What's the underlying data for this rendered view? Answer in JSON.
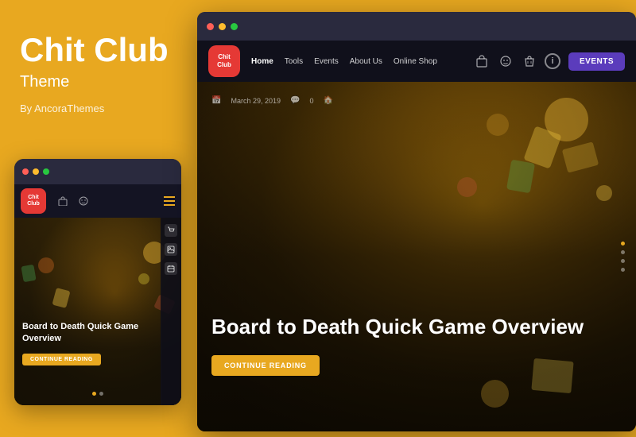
{
  "left": {
    "title": "Chit Club",
    "subtitle": "Theme",
    "byline": "By AncoraThemes"
  },
  "mobile": {
    "logo_line1": "Chit",
    "logo_line2": "Club",
    "nav_icons": [
      "shop",
      "face",
      "menu"
    ],
    "hero_title": "Board to Death Quick Game Overview",
    "read_btn": "CONTINUE READING",
    "dots": [
      true,
      false
    ]
  },
  "desktop": {
    "logo_line1": "Chit",
    "logo_line2": "Club",
    "nav": {
      "links": [
        "Home",
        "Tools",
        "Events",
        "About Us",
        "Online Shop"
      ],
      "active": "Home"
    },
    "events_btn": "EVENTS",
    "meta_date": "March 29, 2019",
    "hero_title": "Board to Death Quick Game Overview",
    "continue_btn": "CONTINUE READING"
  },
  "colors": {
    "background": "#E8A820",
    "logo_red": "#e53935",
    "events_purple": "#5b3cbc",
    "continue_yellow": "#e8a820",
    "dot1": "#e8a820",
    "dot2_inactive": "rgba(255,255,255,0.4)",
    "nav_dark": "rgba(15,15,25,0.9)"
  },
  "dots": {
    "mobile_window": [
      "#ff5f57",
      "#febc2e",
      "#28c840"
    ],
    "desktop_window": [
      "#ff5f57",
      "#febc2e",
      "#28c840"
    ]
  }
}
